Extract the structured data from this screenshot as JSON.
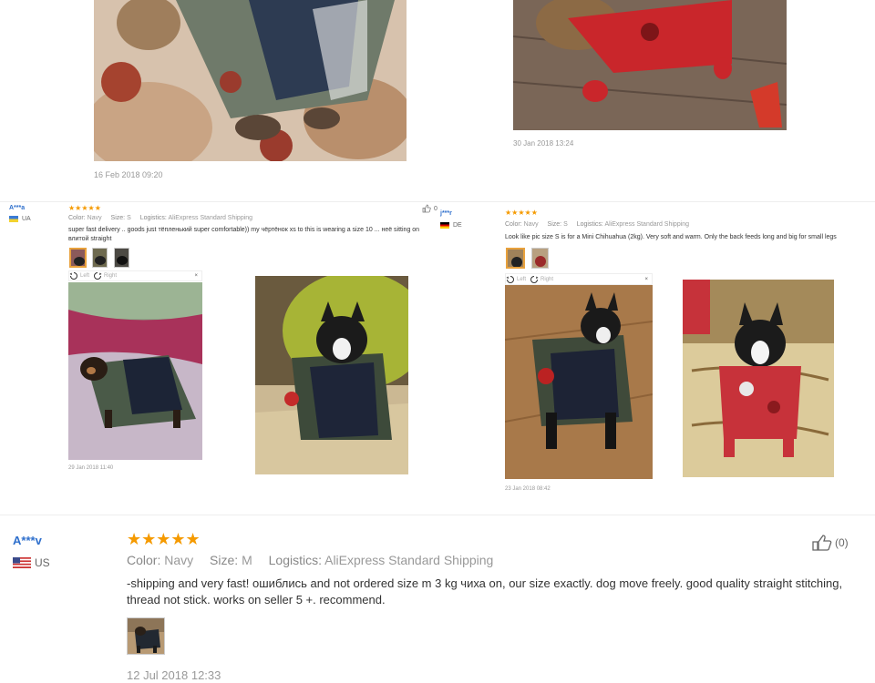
{
  "top": {
    "left_date": "16 Feb 2018 09:20",
    "right_date": "30 Jan 2018 13:24"
  },
  "review1": {
    "name": "A***a",
    "country": "UA",
    "stars": "★★★★★",
    "color_label": "Color:",
    "color": "Navy",
    "size_label": "Size:",
    "size": "S",
    "logistics_label": "Logistics:",
    "logistics": "AliExpress Standard Shipping",
    "helpful_count": "0",
    "text": "super fast delivery .. goods just тёпленький super comfortable)) my чёртёнок xs to this is wearing a size 10 ... неё sitting on влитой straight",
    "rotate_left": "Left",
    "rotate_right": "Right",
    "close": "×",
    "date": "29 Jan 2018 11:40"
  },
  "review2": {
    "name": "j***r",
    "country": "DE",
    "stars": "★★★★★",
    "color_label": "Color:",
    "color": "Navy",
    "size_label": "Size:",
    "size": "S",
    "logistics_label": "Logistics:",
    "logistics": "AliExpress Standard Shipping",
    "text": "Look like pic size S is for a Mini Chihuahua (2kg). Very soft and warm. Only the back feeds long and big for small legs",
    "rotate_left": "Left",
    "rotate_right": "Right",
    "close": "×",
    "date": "23 Jan 2018 08:42"
  },
  "review3": {
    "name": "A***v",
    "country": "US",
    "stars": "★★★★★",
    "color_label": "Color:",
    "color": "Navy",
    "size_label": "Size:",
    "size": "M",
    "logistics_label": "Logistics:",
    "logistics": "AliExpress Standard Shipping",
    "helpful_count": "(0)",
    "text": "-shipping and very fast! ошиблись and not ordered size m 3 kg чиха on, our size exactly. dog move freely. good quality straight stitching, thread not stick. works on seller 5 +. recommend.",
    "date": "12 Jul 2018 12:33"
  },
  "colors": {
    "star": "#f59a00",
    "name": "#2e6fcc",
    "accent_border": "#e8a13c"
  },
  "icons": [
    "thumbs-up-icon",
    "rotate-left-icon",
    "rotate-right-icon",
    "close-icon",
    "flag-ua-icon",
    "flag-de-icon",
    "flag-us-icon"
  ]
}
